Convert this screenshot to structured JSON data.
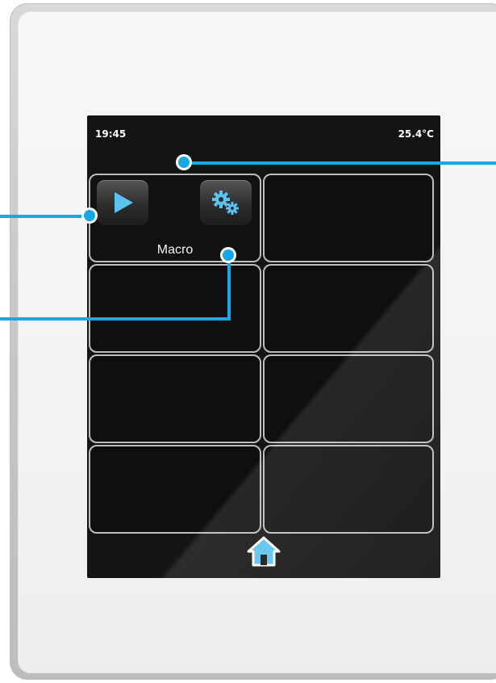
{
  "status_bar": {
    "time": "19:45",
    "temperature": "25.4°C"
  },
  "tiles": [
    {
      "label": "Macro",
      "icons": [
        "play-icon",
        "gears-icon"
      ]
    },
    {
      "label": ""
    },
    {
      "label": ""
    },
    {
      "label": ""
    },
    {
      "label": ""
    },
    {
      "label": ""
    },
    {
      "label": ""
    },
    {
      "label": ""
    }
  ],
  "bottom_nav": {
    "icon": "home-icon"
  },
  "colors": {
    "accent": "#16a7e6",
    "screen_bg": "#141414",
    "tile_border": "#bdbdbd",
    "icon_blue": "#5cc2f0"
  }
}
